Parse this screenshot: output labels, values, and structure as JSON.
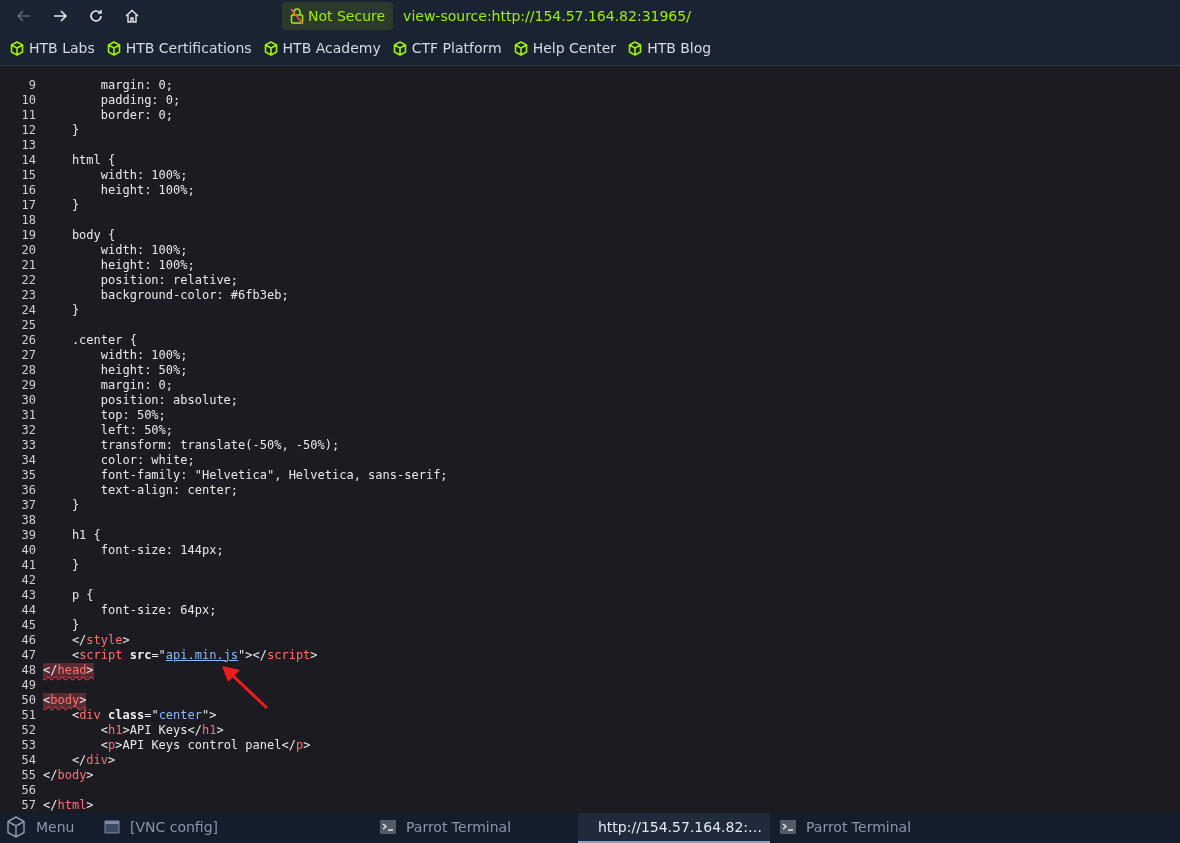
{
  "toolbar": {
    "nav": [
      {
        "kind": "back",
        "disabled": true
      },
      {
        "kind": "forward",
        "disabled": false
      },
      {
        "kind": "reload",
        "disabled": false
      },
      {
        "kind": "home",
        "disabled": false
      }
    ],
    "security": "Not Secure",
    "url": "view-source:http://154.57.164.82:31965/"
  },
  "bookmarks": [
    "HTB Labs",
    "HTB Certifications",
    "HTB Academy",
    "CTF Platform",
    "Help Center",
    "HTB Blog"
  ],
  "source": {
    "lines": [
      {
        "num": "9",
        "parts": [
          {
            "kind": "text",
            "text": "        margin: 0;"
          }
        ]
      },
      {
        "num": "10",
        "parts": [
          {
            "kind": "text",
            "text": "        padding: 0;"
          }
        ]
      },
      {
        "num": "11",
        "parts": [
          {
            "kind": "text",
            "text": "        border: 0;"
          }
        ]
      },
      {
        "num": "12",
        "parts": [
          {
            "kind": "text",
            "text": "    }"
          }
        ]
      },
      {
        "num": "13"
      },
      {
        "num": "14",
        "parts": [
          {
            "kind": "text",
            "text": "    html {"
          }
        ]
      },
      {
        "num": "15",
        "parts": [
          {
            "kind": "text",
            "text": "        width: 100%;"
          }
        ]
      },
      {
        "num": "16",
        "parts": [
          {
            "kind": "text",
            "text": "        height: 100%;"
          }
        ]
      },
      {
        "num": "17",
        "parts": [
          {
            "kind": "text",
            "text": "    }"
          }
        ]
      },
      {
        "num": "18"
      },
      {
        "num": "19",
        "parts": [
          {
            "kind": "text",
            "text": "    body {"
          }
        ]
      },
      {
        "num": "20",
        "parts": [
          {
            "kind": "text",
            "text": "        width: 100%;"
          }
        ]
      },
      {
        "num": "21",
        "parts": [
          {
            "kind": "text",
            "text": "        height: 100%;"
          }
        ]
      },
      {
        "num": "22",
        "parts": [
          {
            "kind": "text",
            "text": "        position: relative;"
          }
        ]
      },
      {
        "num": "23",
        "parts": [
          {
            "kind": "text",
            "text": "        background-color: #6fb3eb;"
          }
        ]
      },
      {
        "num": "24",
        "parts": [
          {
            "kind": "text",
            "text": "    }"
          }
        ]
      },
      {
        "num": "25"
      },
      {
        "num": "26",
        "parts": [
          {
            "kind": "text",
            "text": "    .center {"
          }
        ]
      },
      {
        "num": "27",
        "parts": [
          {
            "kind": "text",
            "text": "        width: 100%;"
          }
        ]
      },
      {
        "num": "28",
        "parts": [
          {
            "kind": "text",
            "text": "        height: 50%;"
          }
        ]
      },
      {
        "num": "29",
        "parts": [
          {
            "kind": "text",
            "text": "        margin: 0;"
          }
        ]
      },
      {
        "num": "30",
        "parts": [
          {
            "kind": "text",
            "text": "        position: absolute;"
          }
        ]
      },
      {
        "num": "31",
        "parts": [
          {
            "kind": "text",
            "text": "        top: 50%;"
          }
        ]
      },
      {
        "num": "32",
        "parts": [
          {
            "kind": "text",
            "text": "        left: 50%;"
          }
        ]
      },
      {
        "num": "33",
        "parts": [
          {
            "kind": "text",
            "text": "        transform: translate(-50%, -50%);"
          }
        ]
      },
      {
        "num": "34",
        "parts": [
          {
            "kind": "text",
            "text": "        color: white;"
          }
        ]
      },
      {
        "num": "35",
        "parts": [
          {
            "kind": "text",
            "text": "        font-family: \"Helvetica\", Helvetica, sans-serif;"
          }
        ]
      },
      {
        "num": "36",
        "parts": [
          {
            "kind": "text",
            "text": "        text-align: center;"
          }
        ]
      },
      {
        "num": "37",
        "parts": [
          {
            "kind": "text",
            "text": "    }"
          }
        ]
      },
      {
        "num": "38"
      },
      {
        "num": "39",
        "parts": [
          {
            "kind": "text",
            "text": "    h1 {"
          }
        ]
      },
      {
        "num": "40",
        "parts": [
          {
            "kind": "text",
            "text": "        font-size: 144px;"
          }
        ]
      },
      {
        "num": "41",
        "parts": [
          {
            "kind": "text",
            "text": "    }"
          }
        ]
      },
      {
        "num": "42"
      },
      {
        "num": "43",
        "parts": [
          {
            "kind": "text",
            "text": "    p {"
          }
        ]
      },
      {
        "num": "44",
        "parts": [
          {
            "kind": "text",
            "text": "        font-size: 64px;"
          }
        ]
      },
      {
        "num": "45",
        "parts": [
          {
            "kind": "text",
            "text": "    }"
          }
        ]
      },
      {
        "num": "46",
        "parts": [
          {
            "kind": "text",
            "text": "    </"
          },
          {
            "kind": "tag",
            "text": "style"
          },
          {
            "kind": "text",
            "text": ">"
          }
        ]
      },
      {
        "num": "47",
        "parts": [
          {
            "kind": "text",
            "text": "    <"
          },
          {
            "kind": "tag",
            "text": "script"
          },
          {
            "kind": "attr",
            "text": " src"
          },
          {
            "kind": "text",
            "text": "=\""
          },
          {
            "kind": "link",
            "text": "api.min.js"
          },
          {
            "kind": "text",
            "text": "\"></"
          },
          {
            "kind": "tag",
            "text": "script"
          },
          {
            "kind": "text",
            "text": ">"
          }
        ]
      },
      {
        "num": "48",
        "error": true,
        "parts": [
          {
            "kind": "text",
            "text": "</"
          },
          {
            "kind": "tag",
            "text": "head"
          },
          {
            "kind": "text",
            "text": ">"
          }
        ]
      },
      {
        "num": "49"
      },
      {
        "num": "50",
        "error": true,
        "parts": [
          {
            "kind": "text",
            "text": "<"
          },
          {
            "kind": "tag",
            "text": "body"
          },
          {
            "kind": "text",
            "text": ">"
          }
        ]
      },
      {
        "num": "51",
        "parts": [
          {
            "kind": "text",
            "text": "    <"
          },
          {
            "kind": "tag",
            "text": "div"
          },
          {
            "kind": "attr",
            "text": " class"
          },
          {
            "kind": "text",
            "text": "=\""
          },
          {
            "kind": "value",
            "text": "center"
          },
          {
            "kind": "text",
            "text": "\">"
          }
        ]
      },
      {
        "num": "52",
        "parts": [
          {
            "kind": "text",
            "text": "        <"
          },
          {
            "kind": "tag",
            "text": "h1"
          },
          {
            "kind": "text",
            "text": ">API Keys</"
          },
          {
            "kind": "tag",
            "text": "h1"
          },
          {
            "kind": "text",
            "text": ">"
          }
        ]
      },
      {
        "num": "53",
        "parts": [
          {
            "kind": "text",
            "text": "        <"
          },
          {
            "kind": "tag",
            "text": "p"
          },
          {
            "kind": "text",
            "text": ">API Keys control panel</"
          },
          {
            "kind": "tag",
            "text": "p"
          },
          {
            "kind": "text",
            "text": ">"
          }
        ]
      },
      {
        "num": "54",
        "parts": [
          {
            "kind": "text",
            "text": "    </"
          },
          {
            "kind": "tag",
            "text": "div"
          },
          {
            "kind": "text",
            "text": ">"
          }
        ]
      },
      {
        "num": "55",
        "parts": [
          {
            "kind": "text",
            "text": "</"
          },
          {
            "kind": "tag",
            "text": "body"
          },
          {
            "kind": "text",
            "text": ">"
          }
        ]
      },
      {
        "num": "56"
      },
      {
        "num": "57",
        "parts": [
          {
            "kind": "text",
            "text": "</"
          },
          {
            "kind": "tag",
            "text": "html"
          },
          {
            "kind": "text",
            "text": ">"
          }
        ]
      }
    ]
  },
  "taskbar": [
    {
      "kind": "menu",
      "label": "Menu",
      "selected": false
    },
    {
      "kind": "window",
      "label": "[VNC config]",
      "selected": false
    },
    {
      "kind": "terminal",
      "label": "Parrot Terminal",
      "selected": false
    },
    {
      "kind": "browser",
      "label": "http://154.57.164.82:…",
      "selected": true
    },
    {
      "kind": "terminal",
      "label": "Parrot Terminal",
      "selected": false
    }
  ]
}
